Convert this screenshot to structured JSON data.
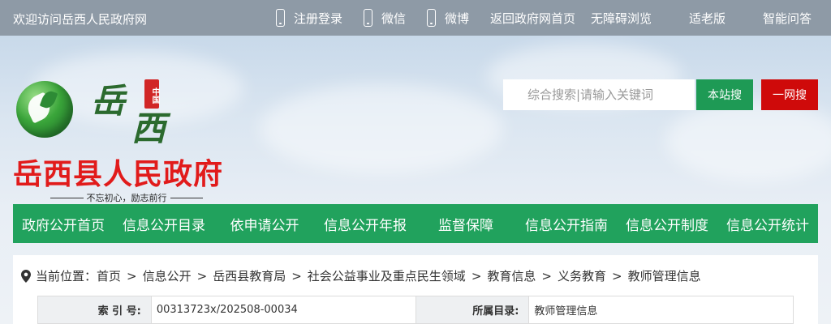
{
  "topbar": {
    "welcome": "欢迎访问岳西人民政府网",
    "register": "注册登录",
    "wechat": "微信",
    "weibo": "微博",
    "back_home": "返回政府网首页",
    "accessibility": "无障碍浏览",
    "elderly": "适老版",
    "smart_qa": "智能问答"
  },
  "logo": {
    "brush_chars": [
      "岳",
      "西"
    ],
    "seal": "中国"
  },
  "header": {
    "gov_name": "岳西县人民政府",
    "slogan": "不忘初心，励志前行"
  },
  "search": {
    "placeholder": "综合搜索|请输入关键词",
    "site_search": "本站搜",
    "all_search": "一网搜"
  },
  "nav": {
    "items": [
      "政府公开首页",
      "信息公开目录",
      "依申请公开",
      "信息公开年报",
      "监督保障",
      "信息公开指南",
      "信息公开制度",
      "信息公开统计"
    ]
  },
  "breadcrumb": {
    "label": "当前位置：",
    "items": [
      "首页",
      "信息公开",
      "岳西县教育局",
      "社会公益事业及重点民生领域",
      "教育信息",
      "义务教育",
      "教师管理信息"
    ],
    "separator": ">"
  },
  "meta": {
    "index_label": "索 引 号:",
    "index_value": "00313723x/202508-00034",
    "category_label": "所属目录:",
    "category_value": "教师管理信息"
  },
  "colors": {
    "nav_green": "#21a25d",
    "search_green": "#1e9a55",
    "search_red": "#cf0a0a",
    "title_red": "#e11b1b",
    "topbar_gray": "#8e9aa6"
  }
}
